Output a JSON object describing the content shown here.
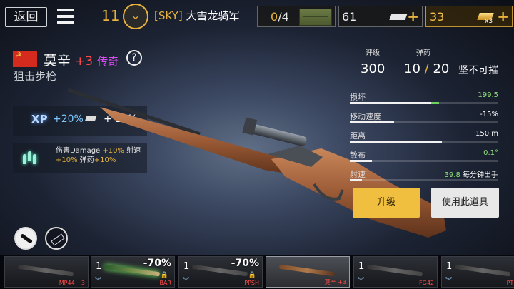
{
  "top_bar": {
    "back_label": "返回",
    "player_level": "11",
    "player_tag": "[SKY]",
    "player_name": "大雪龙骑军",
    "crates_owned": "0",
    "crates_total": "4",
    "ammo_count": "61",
    "gold_count": "33",
    "gold_multiplier": "x3",
    "accent_color": "#e8b23c"
  },
  "weapon": {
    "name": "莫辛",
    "upgrade": "+3",
    "rarity": "传奇",
    "type": "狙击步枪",
    "help_label": "?"
  },
  "bonuses": {
    "xp_label": "XP",
    "xp_bonus": "+20%",
    "ammo_bonus": "+ 10%",
    "damage_line1": "伤害Damage ",
    "damage_pct": "+10%",
    "damage_line1_end": " 射速",
    "damage_line2_a": "+10%",
    "damage_line2_b": " 弹药",
    "damage_line2_c": "+10%"
  },
  "summary": {
    "rating_label": "评级",
    "rating_value": "300",
    "ammo_label": "弹药",
    "ammo_current": "10",
    "ammo_max": "20",
    "durability": "坚不可摧"
  },
  "stats": [
    {
      "label": "损坏",
      "value": "199.5",
      "bar": 0.55,
      "extra": 0.05,
      "value_color": "green"
    },
    {
      "label": "移动速度",
      "value": "-15%",
      "bar": 0.3,
      "extra": 0,
      "value_color": "white"
    },
    {
      "label": "距离",
      "value": "150 m",
      "bar": 0.62,
      "extra": 0,
      "value_color": "white"
    },
    {
      "label": "散布",
      "value": "0.1°",
      "bar": 0.15,
      "extra": 0,
      "value_color": "green"
    },
    {
      "label": "射速",
      "value": "39.8 每分钟出手",
      "bar": 0.08,
      "extra": 0,
      "value_color": "mixed"
    }
  ],
  "actions": {
    "upgrade_label": "升级",
    "use_label": "使用此道具"
  },
  "weapon_strip": [
    {
      "name": "MP44 +3",
      "qty": "",
      "discount": "",
      "locked": false,
      "selected": false,
      "style": "plain"
    },
    {
      "name": "BAR",
      "qty": "1",
      "discount": "-70%",
      "locked": true,
      "selected": false,
      "style": "green"
    },
    {
      "name": "PPSH",
      "qty": "1",
      "discount": "-70%",
      "locked": true,
      "selected": false,
      "style": "plain"
    },
    {
      "name": "莫辛 +3",
      "qty": "",
      "discount": "",
      "locked": false,
      "selected": true,
      "style": "selected"
    },
    {
      "name": "FG42",
      "qty": "1",
      "discount": "",
      "locked": false,
      "selected": false,
      "style": "plain"
    },
    {
      "name": "PTRD",
      "qty": "1",
      "discount": "",
      "locked": false,
      "selected": false,
      "style": "plain"
    }
  ]
}
